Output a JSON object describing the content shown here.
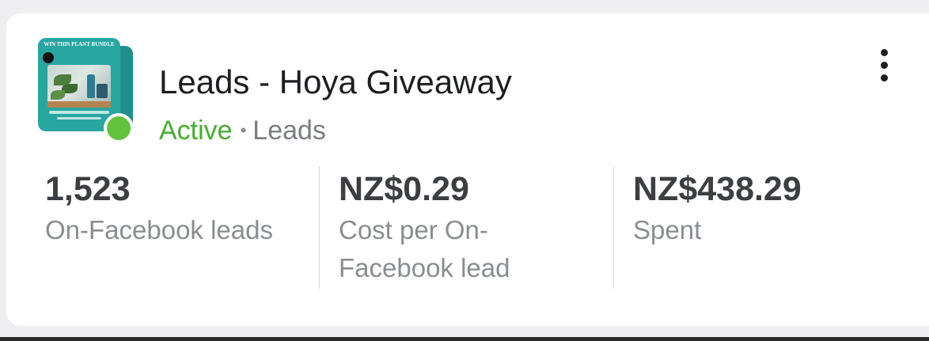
{
  "campaign": {
    "title": "Leads - Hoya Giveaway",
    "status": "Active",
    "separator": "•",
    "objective": "Leads",
    "thumbnail_banner": "WIN THIS PLANT BUNDLE",
    "status_color": "#62c23c",
    "menu_icon": "more-vertical-icon"
  },
  "metrics": [
    {
      "value": "1,523",
      "label": "On-Facebook leads"
    },
    {
      "value": "NZ$0.29",
      "label": "Cost per On-Facebook lead"
    },
    {
      "value": "NZ$438.29",
      "label": "Spent"
    }
  ]
}
